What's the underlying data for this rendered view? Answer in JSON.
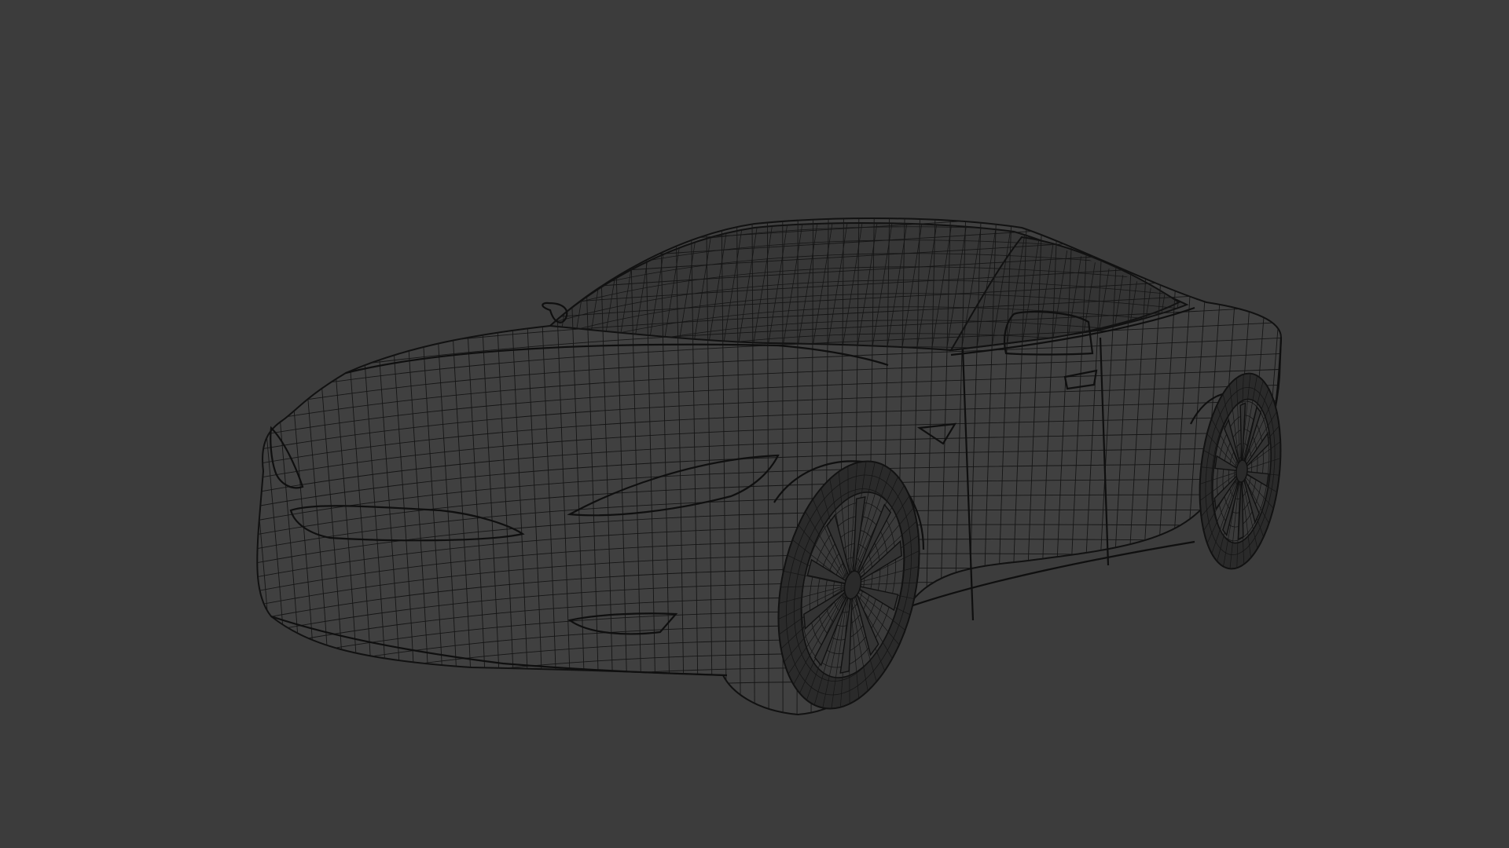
{
  "scene": {
    "background_color": "#3c3c3c",
    "body_color": "#404040",
    "glass_color": "#373737",
    "wire_color": "#151515",
    "wheel_color": "#2f2f2f"
  }
}
